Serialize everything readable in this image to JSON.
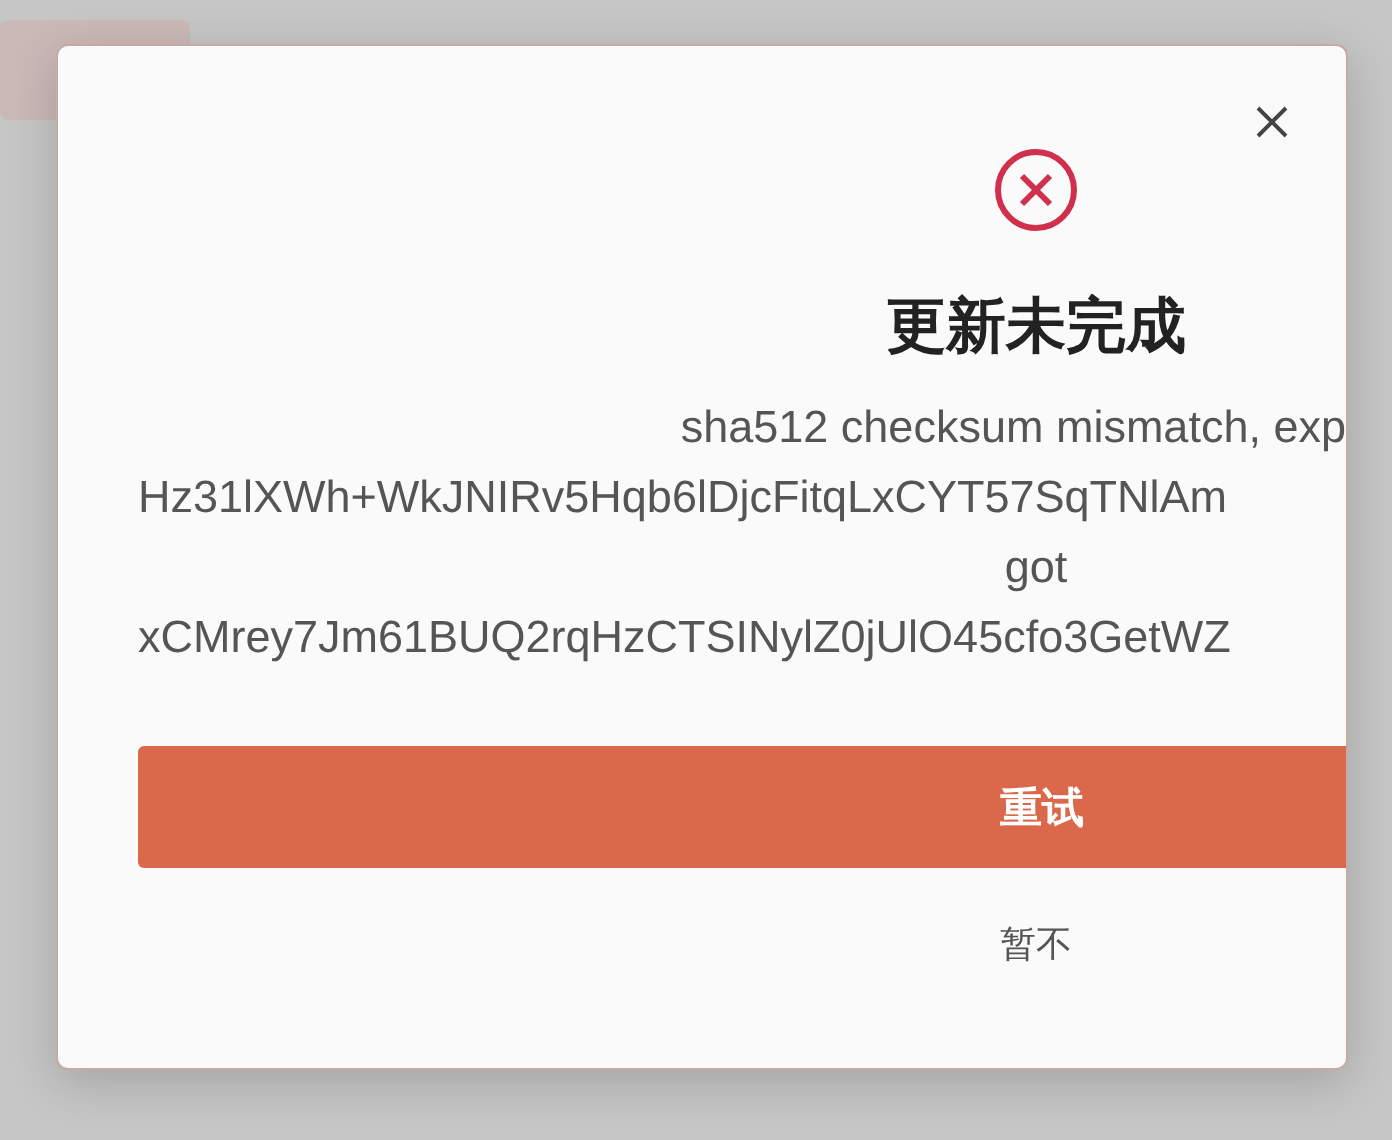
{
  "dialog": {
    "title": "更新未完成",
    "message_lines": [
      {
        "kind": "tail",
        "text": "sha512 checksum mismatch, exp"
      },
      {
        "kind": "hash",
        "text": "Hz31lXWh+WkJNIRv5Hqb6lDjcFitqLxCYT57SqTNlAm"
      },
      {
        "kind": "center",
        "text": "got"
      },
      {
        "kind": "hash",
        "text": "xCMrey7Jm61BUQ2rqHzCTSINylZ0jUlO45cfo3GetWZ"
      }
    ],
    "primary_button": "重试",
    "secondary_button": "暂不"
  }
}
